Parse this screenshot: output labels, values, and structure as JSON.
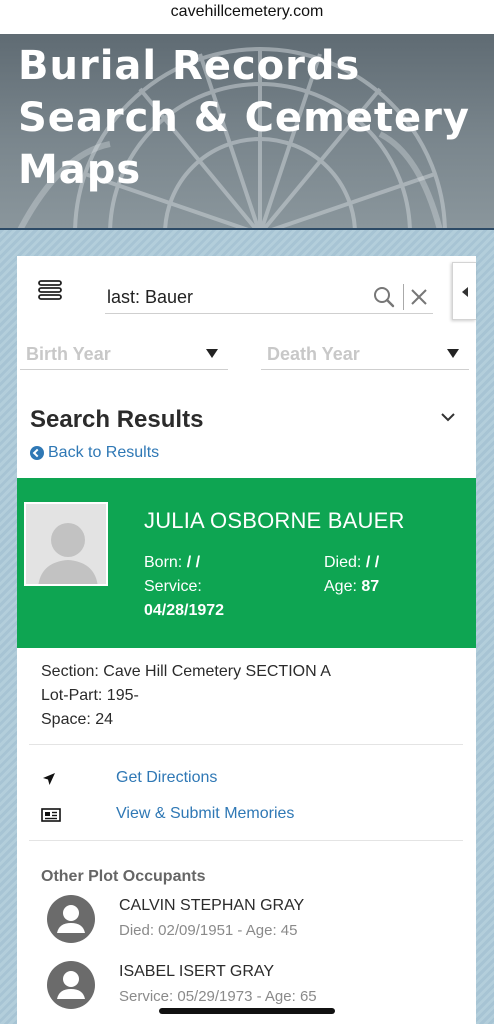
{
  "browser": {
    "url": "cavehillcemetery.com"
  },
  "hero": {
    "title": "Burial Records Search & Cemetery Maps"
  },
  "search": {
    "value": "last: Bauer",
    "birth_year_label": "Birth Year",
    "death_year_label": "Death Year"
  },
  "results": {
    "title": "Search Results",
    "back_label": "Back to Results"
  },
  "record": {
    "name": "JULIA OSBORNE BAUER",
    "born_label": "Born:",
    "born_value": "/ /",
    "died_label": "Died:",
    "died_value": "/ /",
    "service_label": "Service:",
    "service_value": "04/28/1972",
    "age_label": "Age:",
    "age_value": "87",
    "section": "Section: Cave Hill Cemetery SECTION A",
    "lot_part": "Lot-Part: 195-",
    "space": "Space: 24",
    "accent_color": "#0ea552"
  },
  "actions": {
    "directions_label": "Get Directions",
    "memories_label": "View & Submit Memories"
  },
  "occupants": {
    "title": "Other Plot Occupants",
    "items": [
      {
        "name": "CALVIN STEPHAN GRAY",
        "detail": "Died: 02/09/1951 - Age: 45"
      },
      {
        "name": "ISABEL ISERT GRAY",
        "detail": "Service: 05/29/1973 - Age: 65"
      }
    ]
  }
}
